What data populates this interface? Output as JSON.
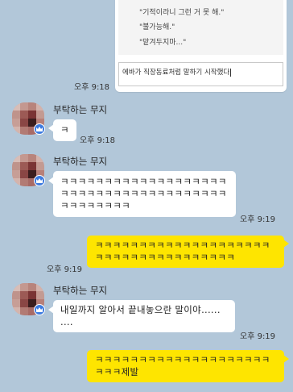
{
  "top_image": {
    "quote_lines": [
      "\"기적이라니 그런 거 못 해.\"",
      "\"불가능해.\"",
      "\"맡겨두지마...\""
    ],
    "compose_text": "에바가 직장동료처럼 말하기 시작했다"
  },
  "messages": [
    {
      "sender": "",
      "time": "오후 9:18"
    },
    {
      "sender": "부탁하는 무지",
      "text": "ㅋ",
      "time": "오후 9:18"
    },
    {
      "sender": "부탁하는 무지",
      "text": "ㅋㅋㅋㅋㅋㅋㅋㅋㅋㅋㅋㅋㅋㅋㅋㅋㅋㅋㅋㅋㅋㅋㅋㅋㅋㅋㅋㅋㅋㅋㅋㅋㅋㅋㅋㅋㅋㅋㅋㅋㅋㅋㅋㅋㅋㅋ",
      "time": "오후 9:19"
    },
    {
      "sender": "me",
      "text": "ㅋㅋㅋㅋㅋㅋㅋㅋㅋㅋㅋㅋㅋㅋㅋㅋㅋㅋㅋㅋㅋㅋㅋㅋㅋㅋㅋㅋㅋㅋㅋㅋㅋㅋㅋㅋ",
      "time": "오후 9:19"
    },
    {
      "sender": "부탁하는 무지",
      "text": "내일까지 알아서 끝내놓으란 말이야...... ....",
      "time": "오후 9:19"
    },
    {
      "sender": "me",
      "text": "ㅋㅋㅋㅋㅋㅋㅋㅋㅋㅋㅋㅋㅋㅋㅋㅋㅋㅋㅋㅋㅋㅋㅋ제발",
      "time": ""
    }
  ],
  "colors": {
    "background": "#b2c7d9",
    "my_bubble": "#fee500",
    "their_bubble": "#ffffff",
    "badge": "#3d7be0"
  },
  "icons": [
    "avatar-image",
    "crown-badge-icon"
  ]
}
